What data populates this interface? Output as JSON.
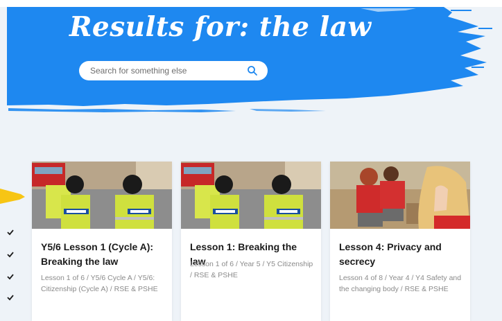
{
  "hero": {
    "title": "Results for: the law",
    "search_placeholder": "Search for something else",
    "search_icon": "search-icon",
    "background_color": "#1e88f0"
  },
  "cards": [
    {
      "title": "Y5/6 Lesson 1 (Cycle A): Breaking the law",
      "meta": "Lesson 1 of 6 / Y5/6 Cycle A / Y5/6: Citizenship (Cycle A) / RSE & PSHE",
      "image": "police-officers-photo"
    },
    {
      "title": "Lesson 1: Breaking the law",
      "meta": "Lesson 1 of 6 / Year 5 / Y5 Citizenship / RSE & PSHE",
      "image": "police-officers-photo"
    },
    {
      "title": "Lesson 4: Privacy and secrecy",
      "meta": "Lesson 4 of 8 / Year 4 / Y4 Safety and the changing body / RSE & PSHE",
      "image": "children-whispering-photo"
    }
  ],
  "colors": {
    "accent_blue": "#1e88f0",
    "accent_yellow": "#f7c514",
    "page_bg": "#eef3f8"
  }
}
